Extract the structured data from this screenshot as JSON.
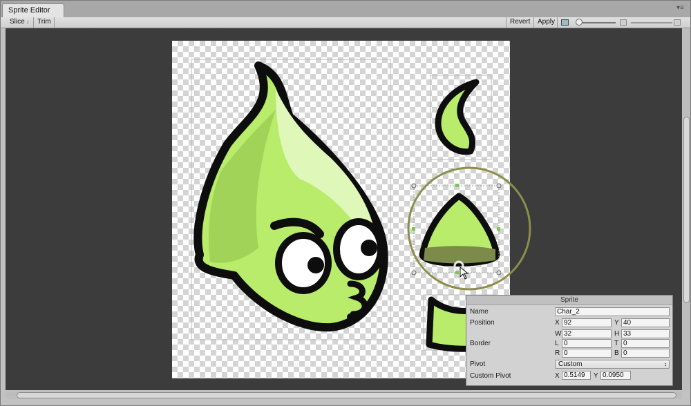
{
  "window": {
    "tab_title": "Sprite Editor",
    "menu_icon": "window-menu-icon"
  },
  "toolbar": {
    "slice_label": "Slice",
    "trim_label": "Trim",
    "revert_label": "Revert",
    "apply_label": "Apply"
  },
  "sprite_panel": {
    "title": "Sprite",
    "name_label": "Name",
    "name_value": "Char_2",
    "position_label": "Position",
    "x_label": "X",
    "x_value": "92",
    "y_label": "Y",
    "y_value": "40",
    "w_label": "W",
    "w_value": "32",
    "h_label": "H",
    "h_value": "33",
    "border_label": "Border",
    "l_label": "L",
    "l_value": "0",
    "t_label": "T",
    "t_value": "0",
    "r_label": "R",
    "r_value": "0",
    "b_label": "B",
    "b_value": "0",
    "pivot_label": "Pivot",
    "pivot_value": "Custom",
    "custom_pivot_label": "Custom Pivot",
    "cpx_label": "X",
    "cpx_value": "0.5149",
    "cpy_label": "Y",
    "cpy_value": "0.0950"
  },
  "colors": {
    "canvas_bg": "#3c3c3c",
    "sprite_green": "#b9ec6a",
    "highlight_ring": "#8b8f4a",
    "handle_green": "#7ac943"
  }
}
